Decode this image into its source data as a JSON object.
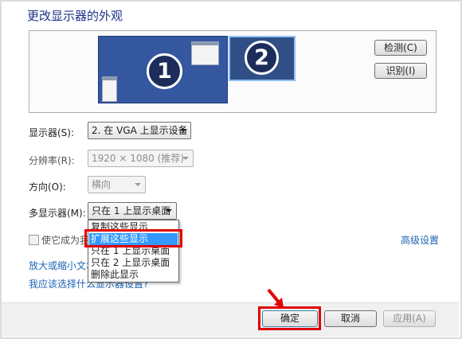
{
  "title": "更改显示器的外观",
  "preview": {
    "monitor1_number": "1",
    "monitor2_number": "2",
    "detect_button": "检测(C)",
    "identify_button": "识别(I)"
  },
  "display": {
    "label": "显示器(S):",
    "value": "2. 在 VGA 上显示设备"
  },
  "resolution": {
    "label": "分辨率(R):",
    "value": "1920 × 1080 (推荐)"
  },
  "orientation": {
    "label": "方向(O):",
    "value": "横向"
  },
  "multiple_displays": {
    "label": "多显示器(M):",
    "value": "只在 1 上显示桌面",
    "options": [
      "复制这些显示",
      "扩展这些显示",
      "只在 1 上显示桌面",
      "只在 2 上显示桌面",
      "删除此显示"
    ],
    "selected_index": 1
  },
  "main_display_checkbox": {
    "label": "使它成为我"
  },
  "advanced_settings_link": "高级设置",
  "links": {
    "text_size": "放大或缩小文本",
    "which_settings": "我应该选择什么显示器设置?"
  },
  "buttons": {
    "ok": "确定",
    "cancel": "取消",
    "apply": "应用(A)"
  },
  "colors": {
    "title": "#1e3287",
    "link": "#1e64b4",
    "highlight": "#e00000",
    "selection": "#3399ff"
  }
}
